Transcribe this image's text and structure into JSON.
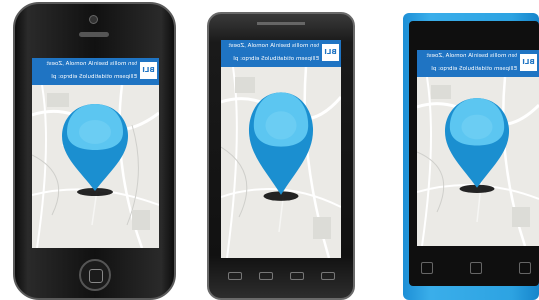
{
  "app_bar": {
    "text_line1": "ten mollis bseinlA nomolA ,Zoest",
    "text_line2": "Ellipsem otidatibuloS  eibrqo: pI",
    "logo": "BLI"
  },
  "pin": {
    "icon": "map-pin-icon",
    "color_light": "#5cc6f1",
    "color_dark": "#1b8fd0"
  },
  "devices": [
    {
      "name": "iphone",
      "body_color": "#111111"
    },
    {
      "name": "android",
      "body_color": "#1a1a1a"
    },
    {
      "name": "nokia",
      "body_color": "#2da3e2"
    }
  ]
}
